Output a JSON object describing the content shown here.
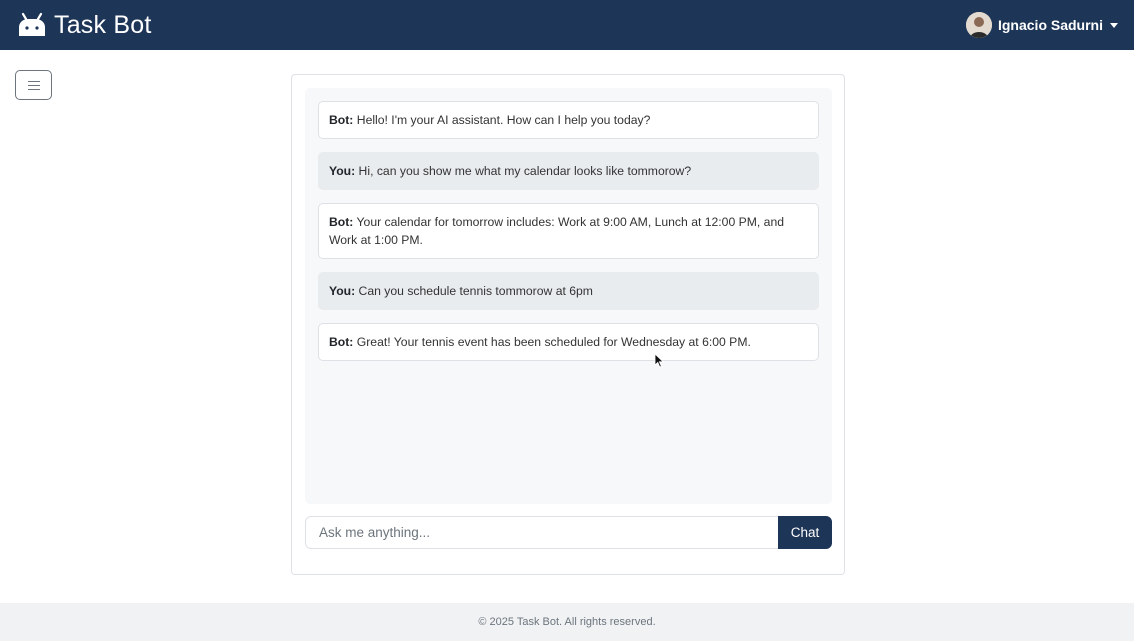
{
  "navbar": {
    "brand_title": "Task Bot",
    "brand_color": "#1d3557",
    "logo_icon": "robot-icon",
    "user_name": "Ignacio Sadurni"
  },
  "sidebar": {
    "toggle_icon": "hamburger-icon"
  },
  "chat": {
    "messages": [
      {
        "speaker": "Bot:",
        "text": " Hello! I'm your AI assistant. How can I help you today?",
        "role": "bot"
      },
      {
        "speaker": "You:",
        "text": " Hi, can you show me what my calendar looks like tommorow?",
        "role": "user"
      },
      {
        "speaker": "Bot:",
        "text": " Your calendar for tomorrow includes: Work at 9:00 AM, Lunch at 12:00 PM, and Work at 1:00 PM.",
        "role": "bot"
      },
      {
        "speaker": "You:",
        "text": " Can you schedule tennis tommorow at 6pm",
        "role": "user"
      },
      {
        "speaker": "Bot:",
        "text": " Great! Your tennis event has been scheduled for Wednesday at 6:00 PM.",
        "role": "bot"
      }
    ],
    "input_placeholder": "Ask me anything...",
    "input_value": "",
    "send_label": "Chat"
  },
  "footer": {
    "text": "© 2025 Task Bot. All rights reserved."
  }
}
